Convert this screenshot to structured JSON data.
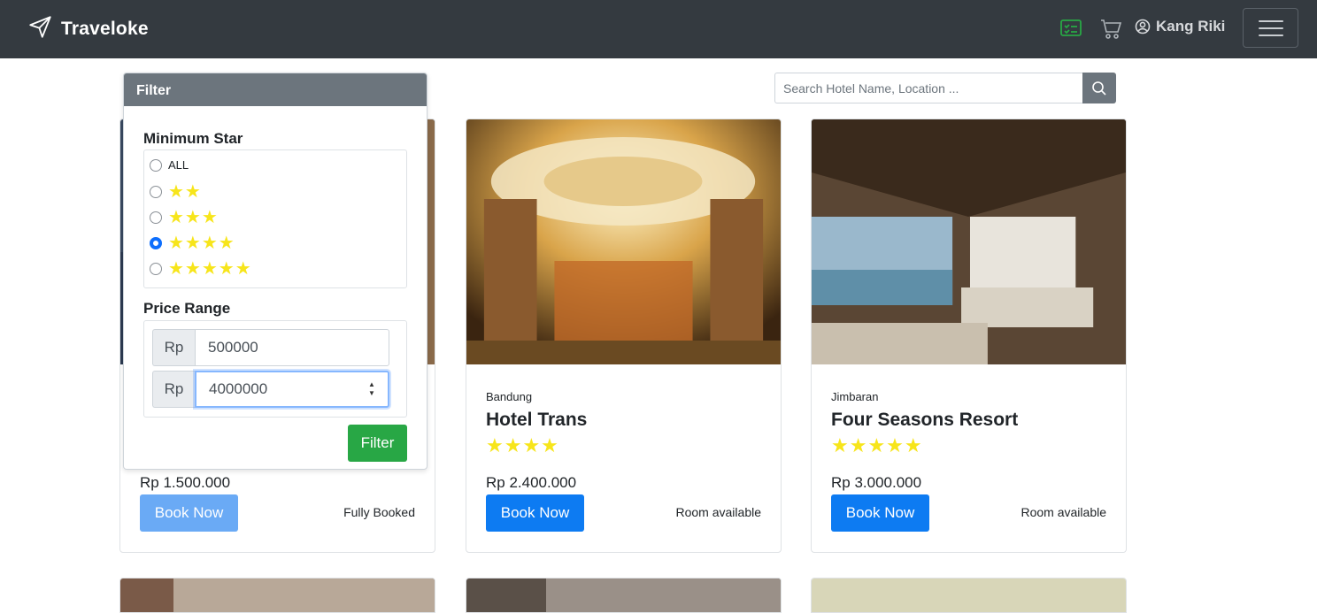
{
  "navbar": {
    "brand": "Traveloke",
    "icons": [
      "paper-plane-icon",
      "checklist-icon",
      "cart-icon",
      "user-circle-icon",
      "menu-icon"
    ],
    "user_name": "Kang Riki"
  },
  "search": {
    "placeholder": "Search Hotel Name, Location ..."
  },
  "filter": {
    "title": "Filter",
    "min_star_title": "Minimum Star",
    "star_options": [
      {
        "label": "ALL",
        "stars": 0,
        "checked": false
      },
      {
        "label": "",
        "stars": 2,
        "checked": false
      },
      {
        "label": "",
        "stars": 3,
        "checked": false
      },
      {
        "label": "",
        "stars": 4,
        "checked": true
      },
      {
        "label": "",
        "stars": 5,
        "checked": false
      }
    ],
    "price_range_title": "Price Range",
    "currency": "Rp",
    "min_price": "500000",
    "max_price": "4000000",
    "button": "Filter"
  },
  "hotels": [
    {
      "location": "",
      "name": "",
      "stars": 0,
      "price": "Rp 1.500.000",
      "button": "Book Now",
      "availability": "Fully Booked",
      "disabled": true
    },
    {
      "location": "Bandung",
      "name": "Hotel Trans",
      "stars": 4,
      "price": "Rp 2.400.000",
      "button": "Book Now",
      "availability": "Room available",
      "disabled": false
    },
    {
      "location": "Jimbaran",
      "name": "Four Seasons Resort",
      "stars": 5,
      "price": "Rp 3.000.000",
      "button": "Book Now",
      "availability": "Room available",
      "disabled": false
    }
  ],
  "colors": {
    "navbar": "#343a40",
    "primary": "#0d7bf2",
    "success": "#28a745",
    "star": "#f7e51b",
    "filter_head": "#6c757d"
  }
}
